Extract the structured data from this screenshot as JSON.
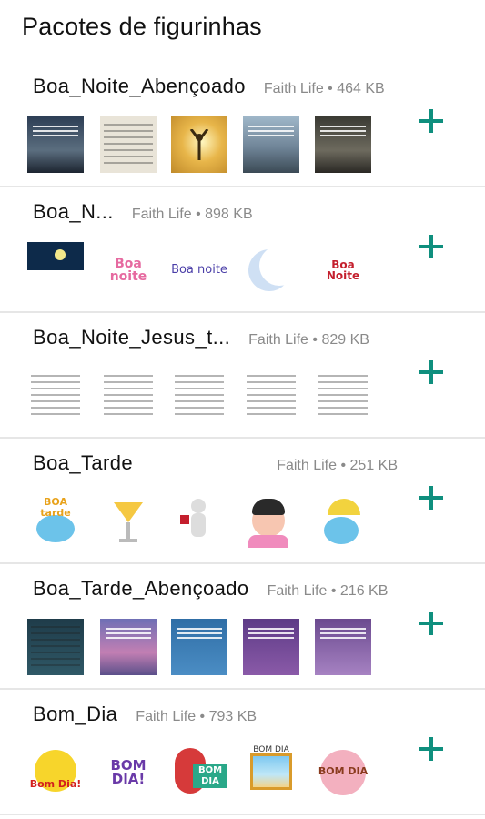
{
  "title": "Pacotes de figurinhas",
  "colors": {
    "accent": "#0f8f7e",
    "meta": "#8a8a8a",
    "divider": "#e6e6e6"
  },
  "packs": [
    {
      "name": "Boa_Noite_Abençoado",
      "author": "Faith Life",
      "size": "464 KB",
      "stickers": [
        "night-photo-sticker",
        "night-photo-sticker",
        "sunrise-praise-sticker",
        "sunset-silhouette-sticker",
        "hands-prayer-sticker"
      ]
    },
    {
      "name": "Boa_N...",
      "author": "Faith Life",
      "size": "898 KB",
      "stickers": [
        "night-sky-sticker",
        "boa-noite-sticker",
        "boa-noite-text-sticker",
        "moon-sticker",
        "boa-noite-lettering-sticker"
      ]
    },
    {
      "name": "Boa_Noite_Jesus_t...",
      "author": "Faith Life",
      "size": "829 KB",
      "stickers": [
        "prayer-text-sticker",
        "prayer-text-sticker",
        "prayer-text-sticker",
        "prayer-text-sticker",
        "prayer-text-sticker"
      ]
    },
    {
      "name": "Boa_Tarde",
      "author": "Faith Life",
      "size": "251 KB",
      "stickers": [
        "boa-tarde-cloud-sticker",
        "cocktail-sticker",
        "figure-sticker",
        "girl-sticker",
        "umbrella-sticker"
      ]
    },
    {
      "name": "Boa_Tarde_Abençoado",
      "author": "Faith Life",
      "size": "216 KB",
      "stickers": [
        "sky-text-sticker",
        "purple-sky-sticker",
        "blue-text-sticker",
        "purple-text-sticker",
        "purple-text-sticker"
      ]
    },
    {
      "name": "Bom_Dia",
      "author": "Faith Life",
      "size": "793 KB",
      "stickers": [
        "sun-bom-dia-sticker",
        "bom-dia-lettering-sticker",
        "woman-bom-dia-sticker",
        "window-sticker",
        "donut-bom-dia-sticker"
      ]
    }
  ],
  "sticker_art": {
    "bom_dia_1": "Bom Dia!",
    "bom_dia_3": "BOM DIA",
    "bom_dia_4": "BOM DIA",
    "bom_dia_5": "BOM DIA",
    "boa_tarde_1": "BOA tarde",
    "boa_noite_2": "Boa noite"
  }
}
